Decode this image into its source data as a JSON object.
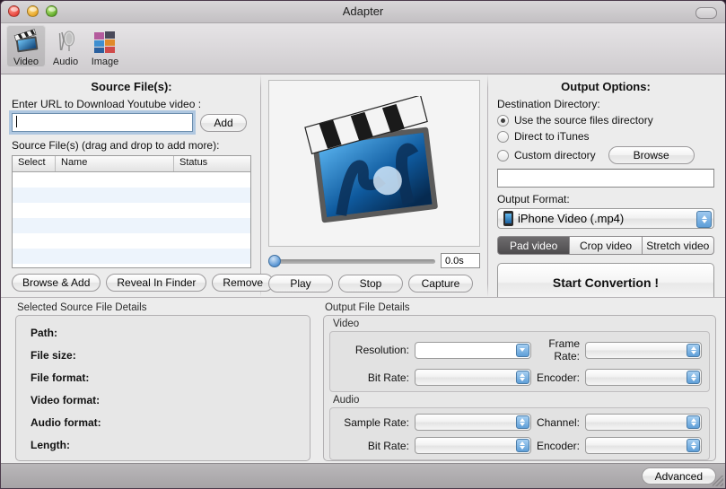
{
  "window": {
    "title": "Adapter",
    "traffic_lights": [
      "close",
      "minimize",
      "zoom"
    ],
    "colors": {
      "close": "#e8453c",
      "minimize": "#e8a72a",
      "zoom": "#63ad2c",
      "accent_blue": "#5d9ed8",
      "segment_active": "#5c5a5c",
      "window_bg": "#ececec"
    }
  },
  "toolbar": {
    "items": [
      {
        "label": "Video",
        "icon": "clapperboard-icon",
        "selected": true
      },
      {
        "label": "Audio",
        "icon": "microphone-icon",
        "selected": false
      },
      {
        "label": "Image",
        "icon": "photos-icon",
        "selected": false
      }
    ]
  },
  "source_panel": {
    "title": "Source File(s):",
    "url_label": "Enter URL to Download Youtube video :",
    "url_value": "",
    "url_placeholder": "",
    "add_button": "Add",
    "list_label": "Source File(s) (drag and drop to add more):",
    "table": {
      "columns": [
        "Select",
        "Name",
        "Status"
      ],
      "rows": []
    },
    "buttons": [
      "Browse & Add",
      "Reveal In Finder",
      "Remove"
    ]
  },
  "preview_panel": {
    "thumbnail_icon": "clapperboard-thumbnail",
    "slider_value": 0,
    "time_display": "0.0s",
    "buttons": [
      "Play",
      "Stop",
      "Capture"
    ]
  },
  "output_panel": {
    "title": "Output Options:",
    "destination_label": "Destination Directory:",
    "destination_options": [
      {
        "label": "Use the source files directory",
        "selected": true
      },
      {
        "label": "Direct to iTunes",
        "selected": false
      },
      {
        "label": "Custom directory",
        "selected": false
      }
    ],
    "browse_button": "Browse",
    "custom_path_value": "",
    "format_label": "Output Format:",
    "format_value": "iPhone Video (.mp4)",
    "format_icon": "iphone-icon",
    "scale_modes": [
      {
        "label": "Pad video",
        "active": true
      },
      {
        "label": "Crop video",
        "active": false
      },
      {
        "label": "Stretch video",
        "active": false
      }
    ],
    "start_button": "Start Convertion !"
  },
  "source_details": {
    "title": "Selected Source File Details",
    "fields": [
      {
        "label": "Path:",
        "value": ""
      },
      {
        "label": "File size:",
        "value": ""
      },
      {
        "label": "File format:",
        "value": ""
      },
      {
        "label": "Video format:",
        "value": ""
      },
      {
        "label": "Audio format:",
        "value": ""
      },
      {
        "label": "Length:",
        "value": ""
      }
    ]
  },
  "output_details": {
    "title": "Output File Details",
    "video": {
      "title": "Video",
      "resolution_label": "Resolution:",
      "resolution_value": "",
      "frame_rate_label": "Frame Rate:",
      "frame_rate_value": "",
      "bit_rate_label": "Bit Rate:",
      "bit_rate_value": "",
      "encoder_label": "Encoder:",
      "encoder_value": ""
    },
    "audio": {
      "title": "Audio",
      "sample_rate_label": "Sample Rate:",
      "sample_rate_value": "",
      "channel_label": "Channel:",
      "channel_value": "",
      "bit_rate_label": "Bit Rate:",
      "bit_rate_value": "",
      "encoder_label": "Encoder:",
      "encoder_value": ""
    }
  },
  "status_bar": {
    "advanced_button": "Advanced"
  }
}
